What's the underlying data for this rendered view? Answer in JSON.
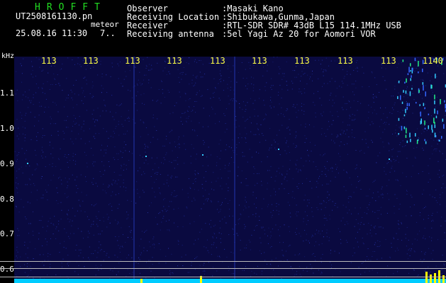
{
  "header": {
    "brand": "HROFFT",
    "filename": "UT2508161130.pn",
    "date_time": "25.08.16 11:30",
    "number": "7..",
    "meteor_label": "meteor",
    "fields": [
      {
        "key": "Observer",
        "value": ":Masaki Kano"
      },
      {
        "key": "Receiving Location",
        "value": ":Shibukawa,Gunma,Japan"
      },
      {
        "key": "Receiver",
        "value": ":RTL-SDR SDR# 43dB L15 114.1MHz USB"
      },
      {
        "key": "Receiving antenna",
        "value": ":5el Yagi Az 20 for Aomori VOR"
      }
    ]
  },
  "x_axis": {
    "ticks": [
      "113",
      "113",
      "113",
      "113",
      "113",
      "113",
      "113",
      "113",
      "113",
      "1140"
    ]
  },
  "y_axis": {
    "unit": "kHz",
    "ticks": [
      "1.1",
      "1.0",
      "0.9",
      "0.8",
      "0.7",
      "0.6"
    ]
  },
  "colors": {
    "background": "#000000",
    "brand": "#22dd22",
    "tick_labels": "#ffff44",
    "spectrum_base": "#0a0a40",
    "noise": "#2233aa",
    "signal": "#33ccff",
    "hot": "#ffff00"
  }
}
